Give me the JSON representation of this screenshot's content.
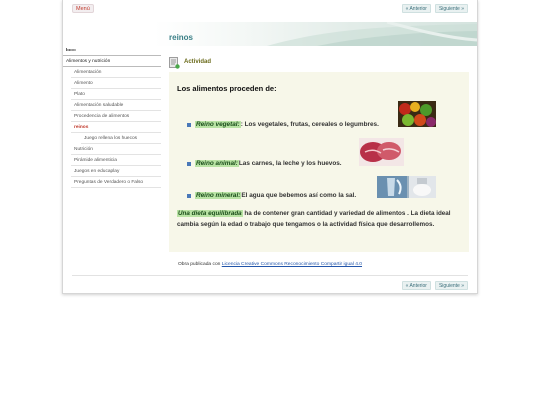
{
  "topbar": {
    "menu_label": "Menú",
    "prev_label": "« Anterior",
    "next_label": "Siguiente »"
  },
  "page": {
    "title": "reinos"
  },
  "sidebar": {
    "items": [
      {
        "label": "Inicio"
      },
      {
        "label": "Alimentos y nutrición"
      },
      {
        "label": "Alimentación"
      },
      {
        "label": "Alimento"
      },
      {
        "label": "Plato"
      },
      {
        "label": "Alimentación saludable"
      },
      {
        "label": "Procedencia de alimentos"
      },
      {
        "label": "reinos"
      },
      {
        "label": "Juego rellena los huecos"
      },
      {
        "label": "Nutrición"
      },
      {
        "label": "Pirámide alimenticia"
      },
      {
        "label": "Juegos en educaplay"
      },
      {
        "label": "Preguntas de Verdadero o Falso"
      }
    ]
  },
  "activity": {
    "label": "Actividad",
    "heading": "Los alimentos proceden de:",
    "items": [
      {
        "keyword": "Reino vegetal:",
        "text": ": Los vegetales, frutas, cereales o legumbres."
      },
      {
        "keyword": "Reino animal:",
        "text": " Las carnes, la leche y los huevos."
      },
      {
        "keyword": "Reino mineral:",
        "text": " El agua que bebemos así como la sal."
      }
    ],
    "paragraph_keyword": "Una dieta equilibrada",
    "paragraph_text": " ha de contener gran cantidad y variedad de alimentos . La dieta ideal cambia según la edad o trabajo que tengamos o la actividad física que desarrollemos."
  },
  "footer": {
    "license_prefix": "Obra publicada con ",
    "license_link": "Licencia Creative Commons Reconocimiento Compartir igual 4.0"
  },
  "bottom_nav": {
    "prev_label": "« Anterior",
    "next_label": "Siguiente »"
  },
  "colors": {
    "accent": "#3a7f86",
    "active": "#c0392b",
    "content_bg": "#f7f7e9",
    "highlight": "#b9e3a4"
  }
}
